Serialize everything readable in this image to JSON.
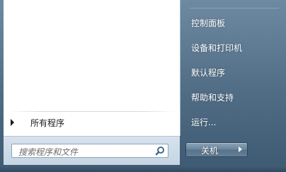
{
  "start_menu": {
    "all_programs_label": "所有程序",
    "search": {
      "placeholder": "搜索程序和文件",
      "icon": "search-icon"
    },
    "right_items": [
      {
        "label": "控制面板"
      },
      {
        "label": "设备和打印机"
      },
      {
        "label": "默认程序"
      },
      {
        "label": "帮助和支持"
      },
      {
        "label": "运行..."
      }
    ],
    "shutdown_label": "关机",
    "colors": {
      "right_pane": "#5f7a91",
      "left_pane": "#ffffff",
      "search_bar": "#c5d5e3"
    }
  }
}
